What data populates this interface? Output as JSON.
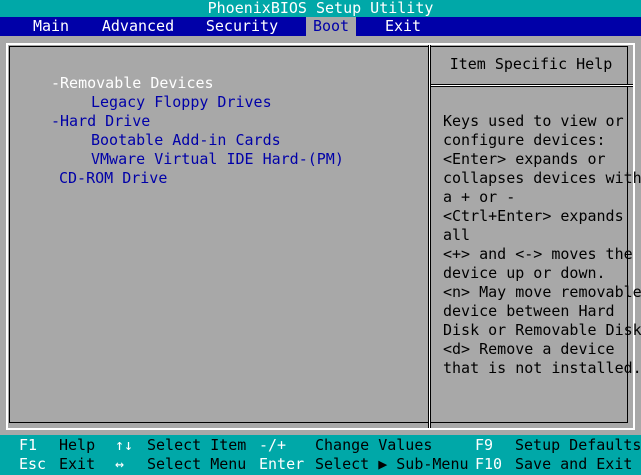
{
  "title": "PhoenixBIOS Setup Utility",
  "menu": [
    {
      "label": "Main",
      "active": false
    },
    {
      "label": "Advanced",
      "active": false
    },
    {
      "label": "Security",
      "active": false
    },
    {
      "label": "Boot",
      "active": true
    },
    {
      "label": "Exit",
      "active": false
    }
  ],
  "boot_items": [
    {
      "label": "-Removable Devices",
      "selected": true
    },
    {
      "label": "Legacy Floppy Drives",
      "selected": false
    },
    {
      "label": "-Hard Drive",
      "selected": false
    },
    {
      "label": "Bootable Add-in Cards",
      "selected": false
    },
    {
      "label": "VMware Virtual IDE Hard-(PM)",
      "selected": false
    },
    {
      "label": "CD-ROM Drive",
      "selected": false
    }
  ],
  "help": {
    "title": "Item Specific Help",
    "lines": [
      "Keys used to view or",
      "configure devices:",
      "<Enter> expands or",
      "collapses devices with",
      "a + or -",
      "<Ctrl+Enter> expands",
      "all",
      "<+> and <-> moves the",
      "device up or down.",
      "<n> May move removable",
      "device between Hard",
      "Disk or Removable Disk",
      "<d> Remove a device",
      "that is not installed."
    ]
  },
  "footer": {
    "row1": [
      {
        "key": "F1",
        "desc": "Help"
      },
      {
        "key": "↑↓",
        "desc": "Select Item"
      },
      {
        "key": "-/+",
        "desc": "Change Values"
      },
      {
        "key": "F9",
        "desc": "Setup Defaults"
      }
    ],
    "row2": [
      {
        "key": "Esc",
        "desc": "Exit"
      },
      {
        "key": "↔",
        "desc": "Select Menu"
      },
      {
        "key": "Enter",
        "desc": "Select ▶ Sub-Menu"
      },
      {
        "key": "F10",
        "desc": "Save and Exit"
      }
    ]
  },
  "colors": {
    "bios_blue": "#0000a8",
    "bios_cyan": "#00a8a8",
    "bios_gray": "#a8a8a8",
    "text_white": "#ffffff"
  }
}
